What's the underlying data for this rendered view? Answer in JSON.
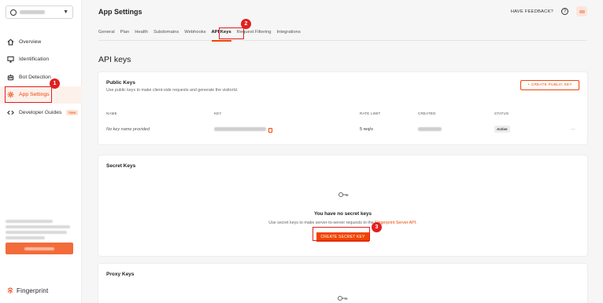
{
  "sidebar": {
    "items": [
      {
        "label": "Overview",
        "icon": "home-icon"
      },
      {
        "label": "Identification",
        "icon": "monitor-icon"
      },
      {
        "label": "Bot Detection",
        "icon": "robot-icon"
      },
      {
        "label": "App Settings",
        "icon": "gear-icon"
      },
      {
        "label": "Developer Guides",
        "icon": "code-icon",
        "badge": "New"
      }
    ],
    "logo_text": "Fingerprint"
  },
  "header": {
    "title": "App Settings",
    "feedback": "HAVE FEEDBACK?",
    "help": "?"
  },
  "tabs": [
    "General",
    "Plan",
    "Health",
    "Subdomains",
    "Webhooks",
    "API Keys",
    "Request Filtering",
    "Integrations"
  ],
  "page_title": "API keys",
  "public_keys": {
    "title": "Public Keys",
    "description": "Use public keys to make client-side requests and generate the visitorId.",
    "create_button": "+  CREATE PUBLIC KEY",
    "columns": [
      "NAME",
      "KEY",
      "RATE LIMIT",
      "CREATED",
      "STATUS"
    ],
    "row": {
      "name": "No key name provided",
      "rate_limit": "5 req/s",
      "status": "Active",
      "menu": "···"
    }
  },
  "secret_keys": {
    "title": "Secret Keys",
    "empty_title": "You have no secret keys",
    "empty_desc": "Use secret keys to make server-to-server requests to the ",
    "empty_link": "Fingerprint Server API.",
    "create_button": "CREATE SECRET KEY"
  },
  "proxy_keys": {
    "title": "Proxy Keys"
  },
  "annotations": [
    "1",
    "2",
    "3"
  ],
  "colors": {
    "accent": "#f04405",
    "annotation": "#e02020"
  }
}
